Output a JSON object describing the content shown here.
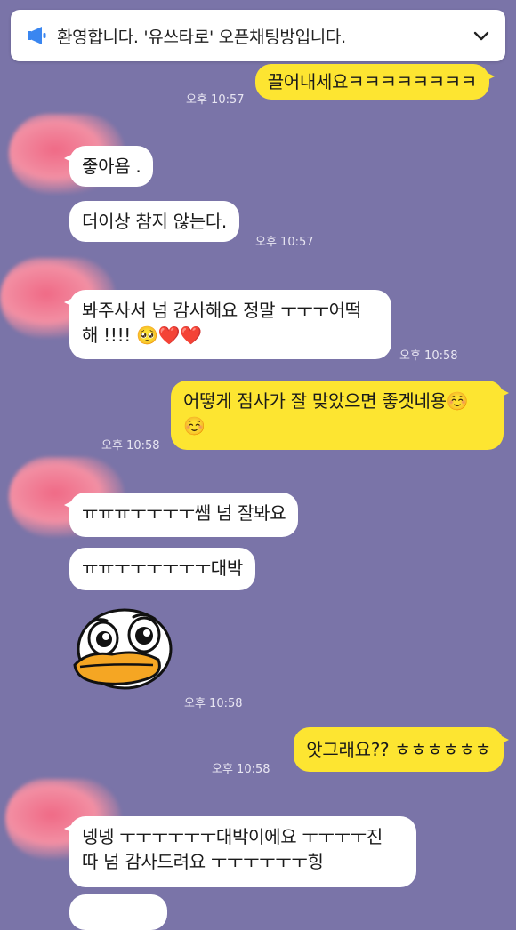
{
  "notice": {
    "text": "환영합니다. '유쓰타로' 오픈채팅방입니다.",
    "icon": "megaphone-icon",
    "toggle_icon": "chevron-down-icon"
  },
  "messages": [
    {
      "side": "mine",
      "text": "끌어내세요ㅋㅋㅋㅋㅋㅋㅋㅋ",
      "time": "오후 10:57"
    },
    {
      "side": "other",
      "text": "좋아욤 ."
    },
    {
      "side": "other",
      "text": "더이상 참지 않는다.",
      "time": "오후 10:57"
    },
    {
      "side": "other",
      "line1": "봐주사서 넘 감사해요 정말 ㅜㅜㅜ어떡",
      "line2": "해 !!!!",
      "emoji": "🥺❤️❤️",
      "time": "오후 10:58"
    },
    {
      "side": "mine",
      "line1": "어떻게 점사가 잘 맞았으면 좋겟네용☺️",
      "line2": "☺️",
      "time": "오후 10:58"
    },
    {
      "side": "other",
      "text": "ㅠㅠㅠㅜㅜㅜㅜ쌤 넘 잘봐요"
    },
    {
      "side": "other",
      "text": "ㅠㅠㅜㅜㅜㅜㅜㅜ대박"
    },
    {
      "side": "other",
      "type": "sticker",
      "time": "오후 10:58"
    },
    {
      "side": "mine",
      "text": "앗그래요?? ㅎㅎㅎㅎㅎㅎ",
      "time": "오후 10:58"
    },
    {
      "side": "other",
      "line1": "넹넹 ㅜㅜㅜㅜㅜㅜ대박이에요 ㅜㅜㅜㅜ진",
      "line2": "따 넘 감사드려요 ㅜㅜㅜㅜㅜㅜ힝"
    }
  ],
  "colors": {
    "background": "#7a74a8",
    "mine": "#fde531",
    "other": "#ffffff",
    "accent": "#3a86f0"
  }
}
